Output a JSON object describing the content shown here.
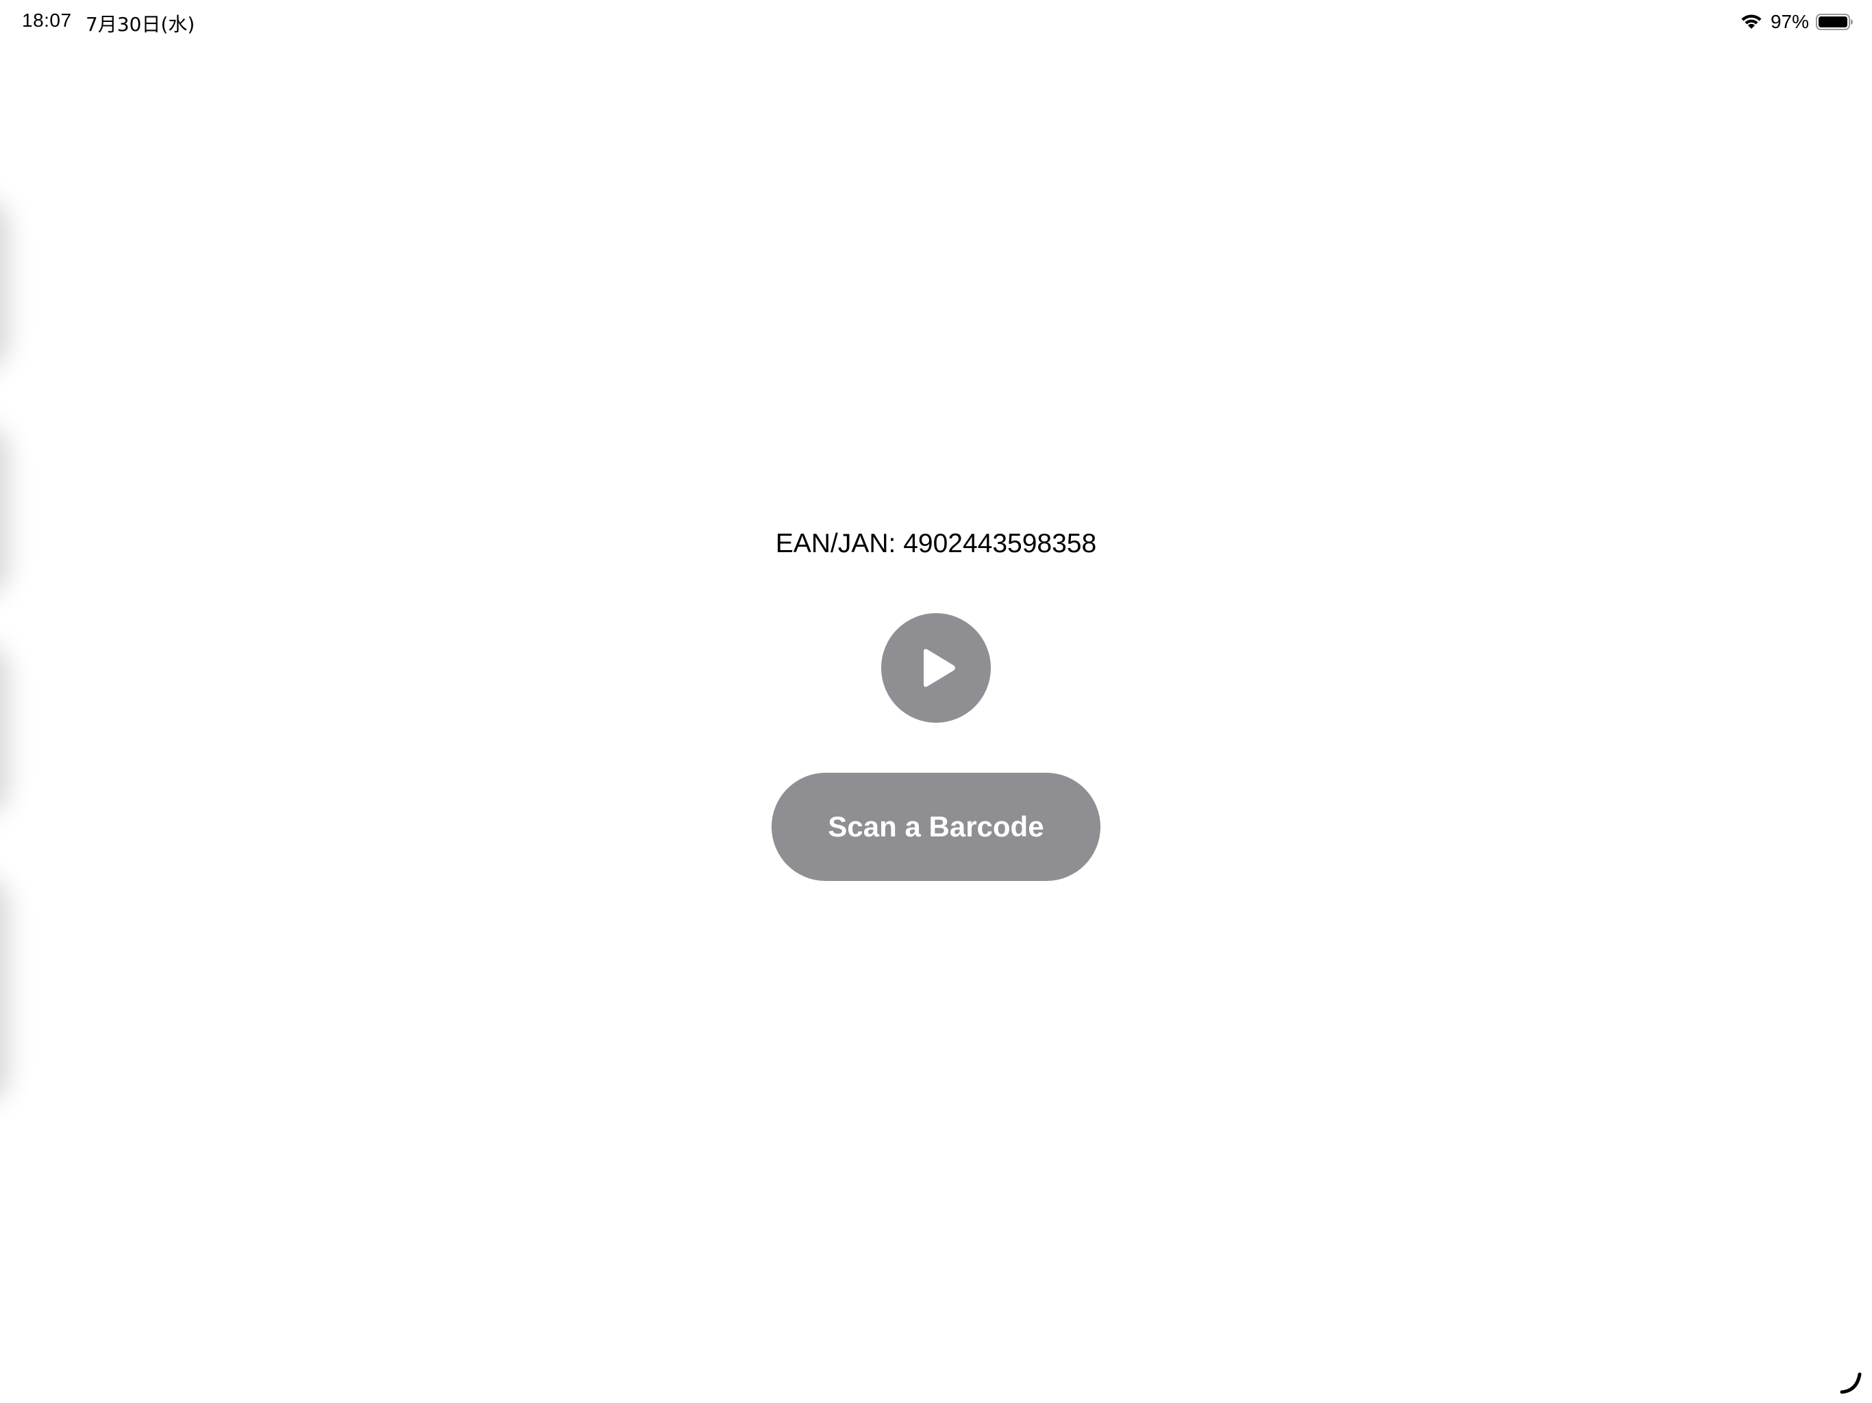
{
  "status_bar": {
    "time": "18:07",
    "date": "7月30日(水)",
    "battery_percent": "97%",
    "wifi_icon": "wifi-icon",
    "battery_icon": "battery-icon"
  },
  "main": {
    "ean_text": "EAN/JAN: 4902443598358",
    "play_icon": "play-icon",
    "scan_button_label": "Scan a Barcode"
  },
  "colors": {
    "button_gray": "#8e8e93",
    "background": "#ffffff",
    "text": "#000000"
  }
}
